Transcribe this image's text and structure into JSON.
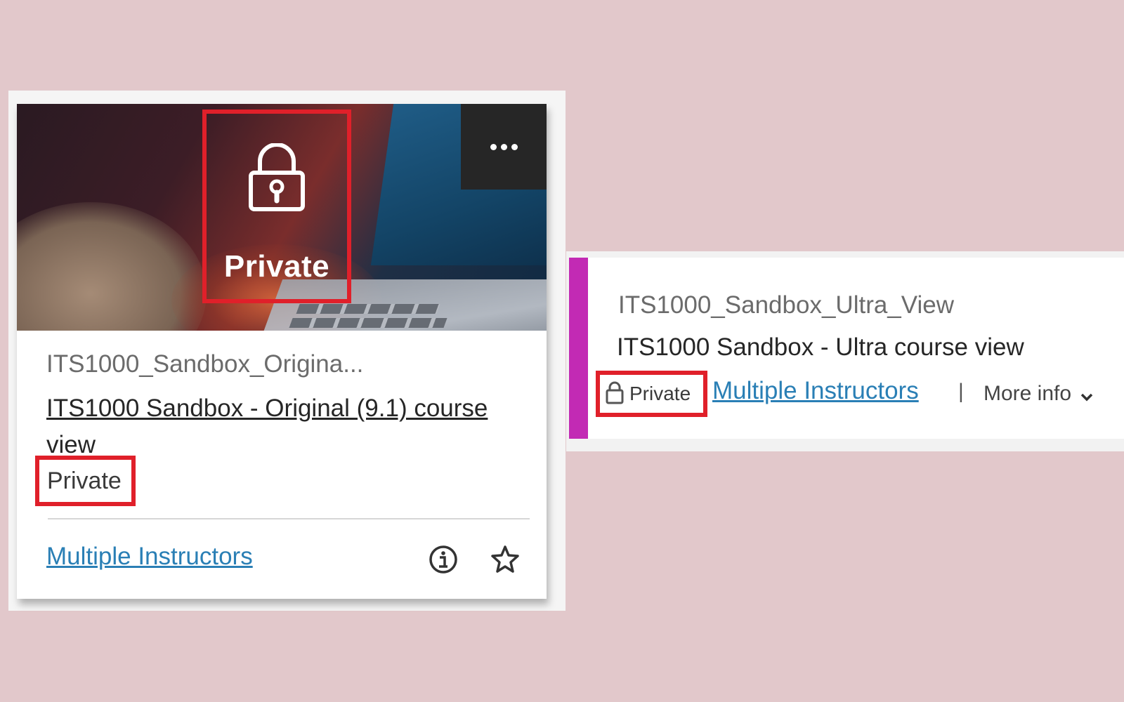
{
  "card_view": {
    "more_icon": "more-horizontal-icon",
    "overlay": {
      "icon": "lock-icon",
      "label": "Private"
    },
    "course_code": "ITS1000_Sandbox_Origina...",
    "course_title_linked": "ITS1000 Sandbox - Original (9.1) course",
    "course_title_rest": "view",
    "private_label": "Private",
    "instructors_link": "Multiple Instructors",
    "info_icon": "info-icon",
    "star_icon": "star-icon"
  },
  "list_view": {
    "accent_color": "#c22ab4",
    "course_code": "ITS1000_Sandbox_Ultra_View",
    "course_title": "ITS1000 Sandbox - Ultra course view",
    "private_icon": "lock-icon",
    "private_label": "Private",
    "instructors_link": "Multiple Instructors",
    "separator": "|",
    "more_info_label": "More info",
    "more_info_icon": "chevron-down-icon"
  },
  "colors": {
    "background": "#e2c8cb",
    "highlight": "#e0202a",
    "link": "#2a7fb5"
  }
}
